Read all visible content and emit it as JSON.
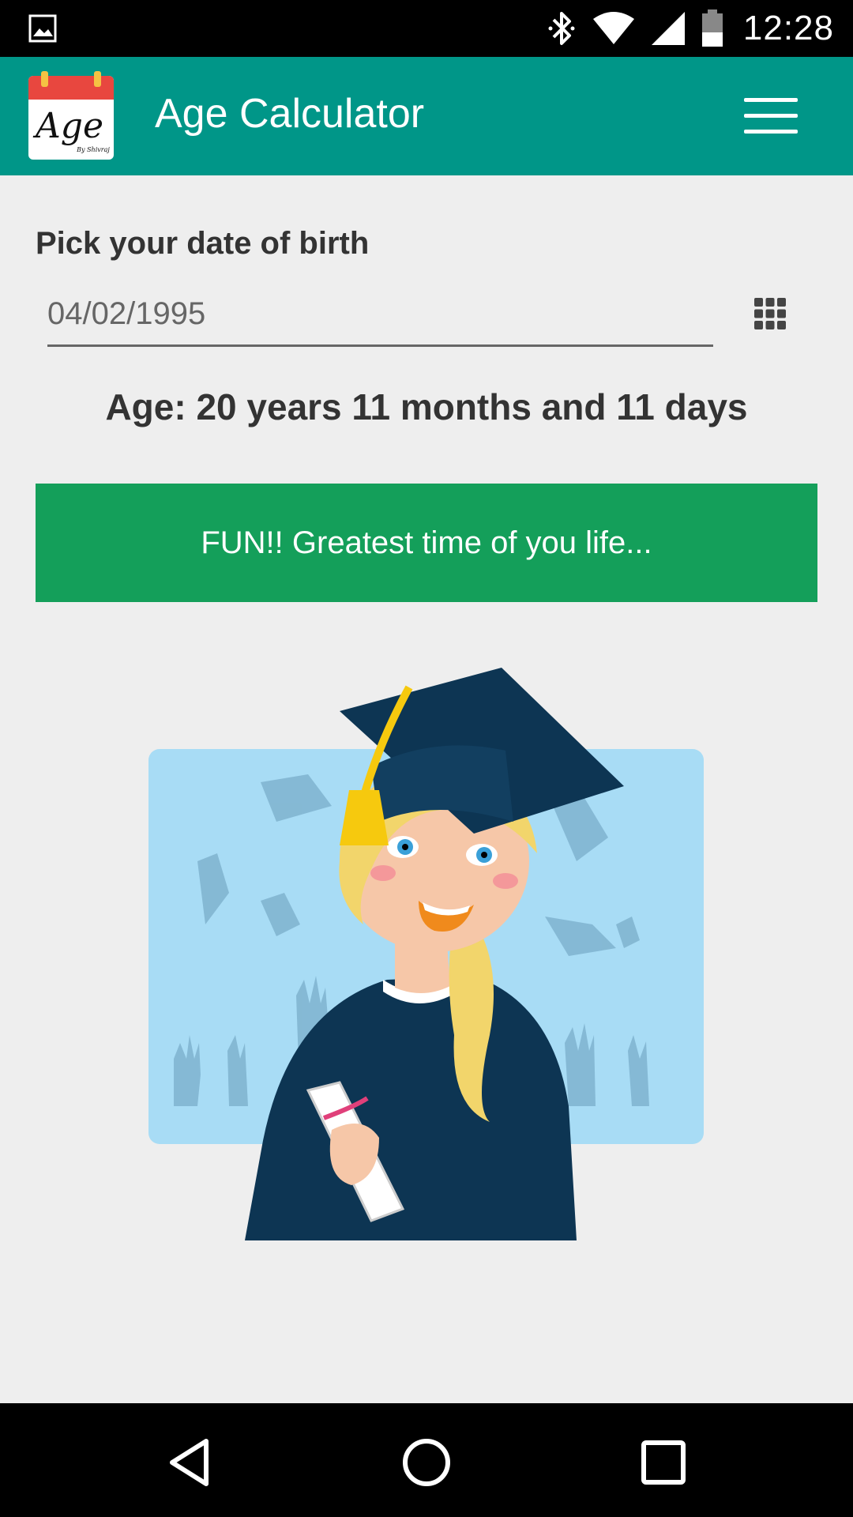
{
  "status_bar": {
    "time": "12:28",
    "icons": [
      "gallery-icon",
      "bluetooth-icon",
      "wifi-icon",
      "signal-icon",
      "battery-icon"
    ]
  },
  "app_bar": {
    "logo_text": "Age",
    "logo_subtext": "By Shivraj",
    "title": "Age Calculator",
    "menu_icon": "hamburger-menu-icon",
    "color": "#009688"
  },
  "form": {
    "label": "Pick your date of birth",
    "date_value": "04/02/1995",
    "calendar_icon": "grid-calendar-icon"
  },
  "result": {
    "age_text": "Age: 20 years 11 months and 11 days"
  },
  "banner": {
    "text": "FUN!! Greatest time of you life...",
    "color": "#149f5a"
  },
  "illustration": {
    "description_icon": "graduate-girl-illustration"
  },
  "nav_bar": {
    "icons": [
      "back-icon",
      "home-icon",
      "recents-icon"
    ]
  }
}
